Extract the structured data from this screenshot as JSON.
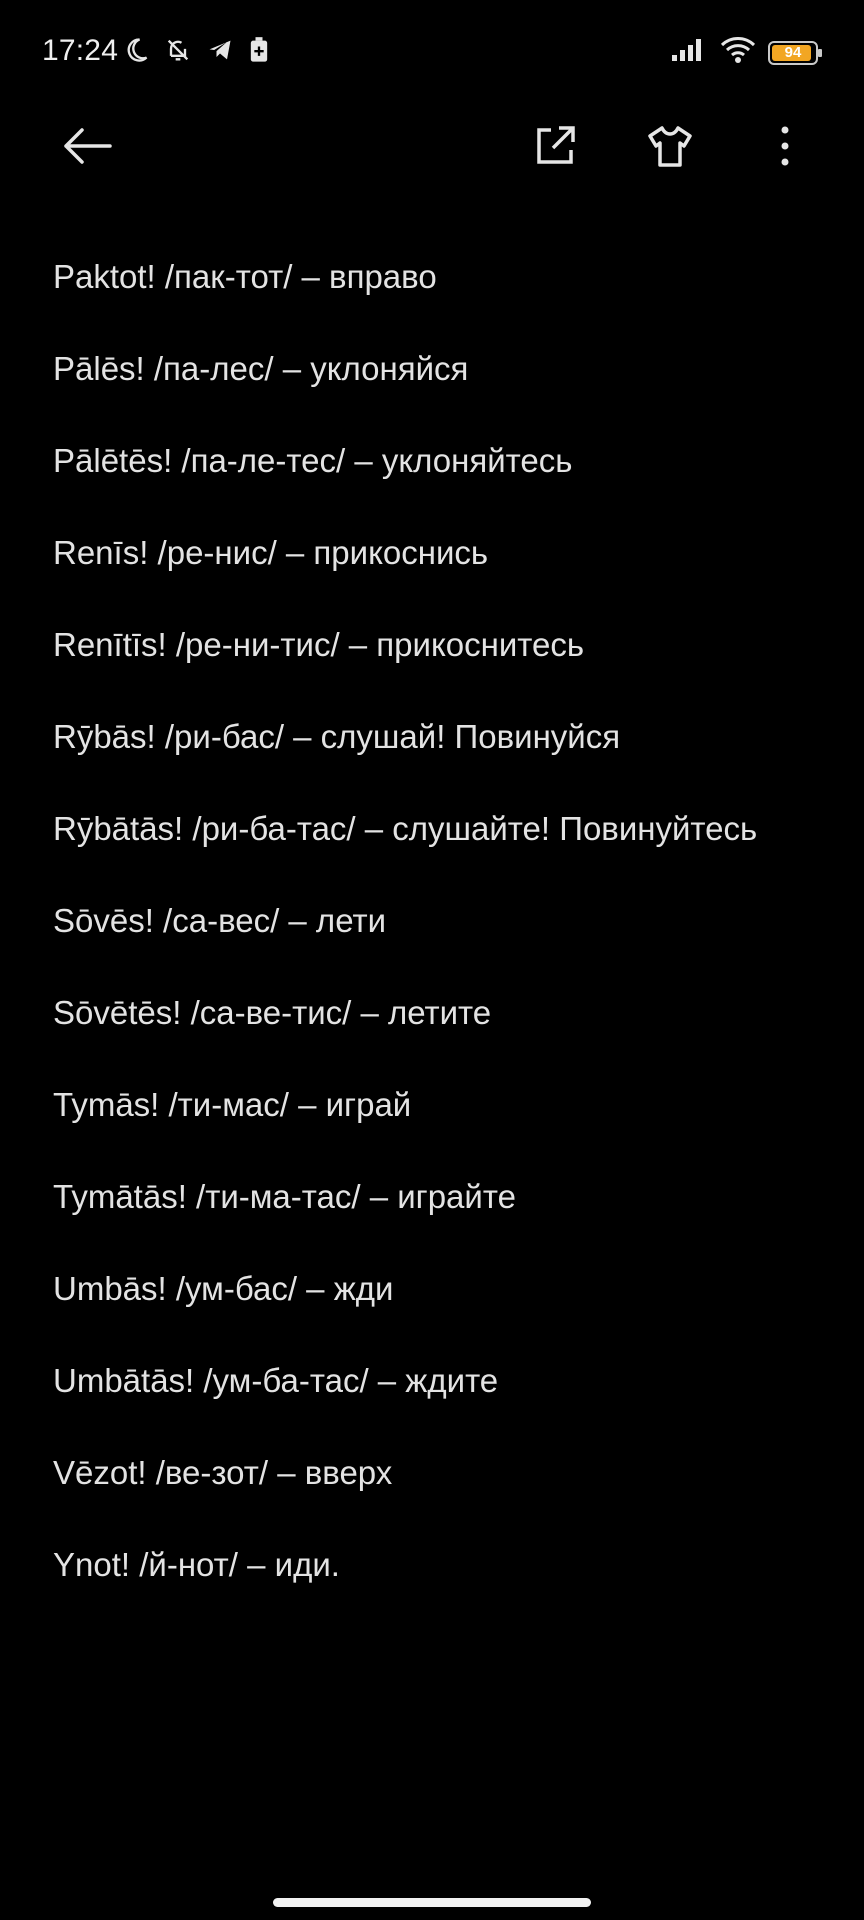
{
  "status_bar": {
    "time": "17:24",
    "battery_level": "94",
    "battery_fraction": 0.94,
    "battery_color": "#f2a623",
    "icons_left": [
      "moon-icon",
      "bell-off-icon",
      "telegram-icon",
      "battery-saver-icon"
    ],
    "icons_right": [
      "signal-icon",
      "wifi-icon",
      "battery-icon"
    ]
  },
  "toolbar": {
    "icons": [
      "back-arrow-icon",
      "share-external-icon",
      "tshirt-icon",
      "more-vert-icon"
    ]
  },
  "entries": [
    "Paktot! /пак-тот/ – вправо",
    "Pālēs! /па-лес/ – уклоняйся",
    "Pālētēs! /па-ле-тес/ – уклоняйтесь",
    "Renīs! /ре-нис/ – прикоснись",
    "Renītīs! /ре-ни-тис/ – прикоснитесь",
    "Rȳbās! /ри-бас/ – слушай! Повинуйся",
    "Rȳbātās! /ри-ба-тас/ – слушайте! Повинуйтесь",
    "Sōvēs! /са-вес/ – лети",
    "Sōvētēs! /са-ве-тис/ – летите",
    "Tymās! /ти-мас/ – играй",
    "Tymātās! /ти-ма-тас/ – играйте",
    "Umbās! /ум-бас/ – жди",
    "Umbātās! /ум-ба-тас/ – ждите",
    "Vēzot! /ве-зот/ – вверх",
    "Ynot! /й-нот/ – иди."
  ]
}
